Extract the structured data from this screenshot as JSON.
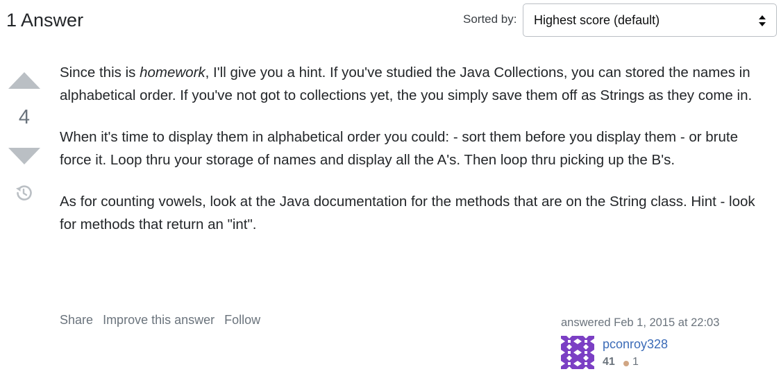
{
  "header": {
    "answers_title": "1 Answer",
    "sort_label": "Sorted by:",
    "sort_selected": "Highest score (default)"
  },
  "vote": {
    "score": "4"
  },
  "post": {
    "paragraph1_before": "Since this is ",
    "paragraph1_em": "homework",
    "paragraph1_after": ", I'll give you a hint. If you've studied the Java Collections, you can stored the names in alphabetical order. If you've not got to collections yet, the you simply save them off as Strings as they come in.",
    "paragraph2": "When it's time to display them in alphabetical order you could: - sort them before you display them - or brute force it. Loop thru your storage of names and display all the A's. Then loop thru picking up the B's.",
    "paragraph3": "As for counting vowels, look at the Java documentation for the methods that are on the String class. Hint - look for methods that return an \"int\"."
  },
  "post_menu": {
    "share": "Share",
    "improve": "Improve this answer",
    "follow": "Follow"
  },
  "user": {
    "action_time": "answered Feb 1, 2015 at 22:03",
    "name": "pconroy328",
    "reputation": "41",
    "bronze_badges": "1"
  },
  "colors": {
    "link": "#3b6bb7",
    "muted": "#6a737c",
    "vote_arrow": "#babfc4",
    "avatar": "#7b3fc4",
    "bronze": "#d1a684"
  },
  "icons": {
    "vote_up": "triangle-up-icon",
    "vote_down": "triangle-down-icon",
    "history": "history-icon",
    "sort": "sort-arrows-icon"
  }
}
